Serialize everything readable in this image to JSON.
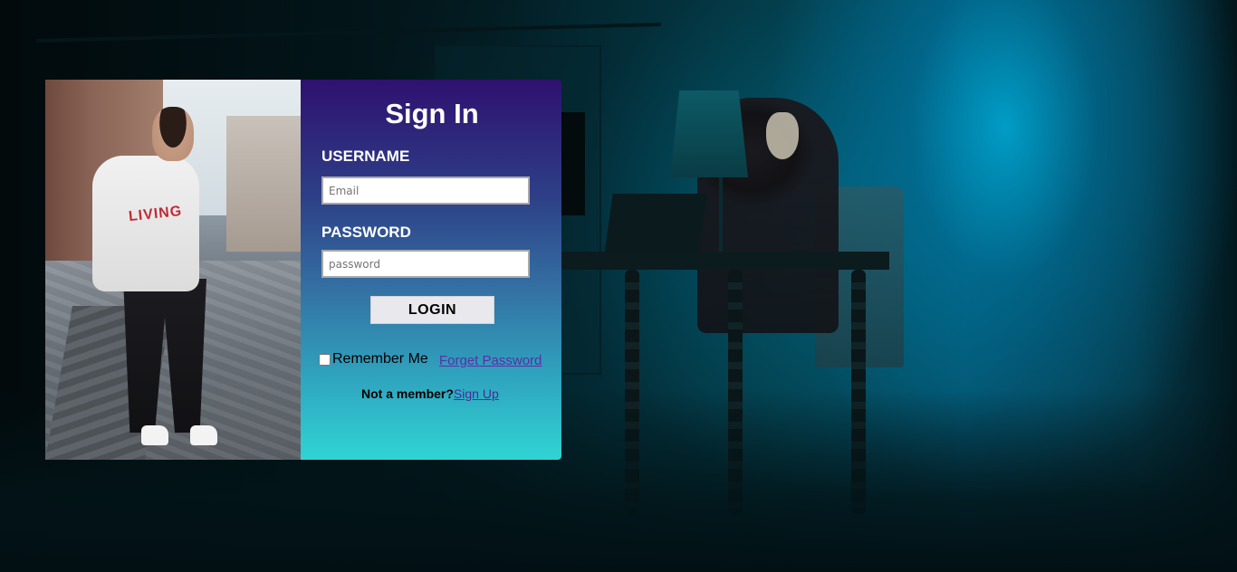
{
  "form": {
    "title": "Sign In",
    "username_label": "USERNAME",
    "username_placeholder": "Email",
    "password_label": "PASSWORD",
    "password_placeholder": "password",
    "login_label": "LOGIN",
    "remember_label": "Remember Me",
    "remember_checked": false,
    "forget_label": "Forget Password",
    "not_member_label": "Not a member?",
    "signup_label": "Sign Up"
  },
  "photo": {
    "shirt_text": "LIVING"
  },
  "colors": {
    "form_gradient_top": "#2f1170",
    "form_gradient_bottom": "#2fd4d4",
    "link": "#5a2ea8",
    "button_bg": "#e9e9ed"
  }
}
